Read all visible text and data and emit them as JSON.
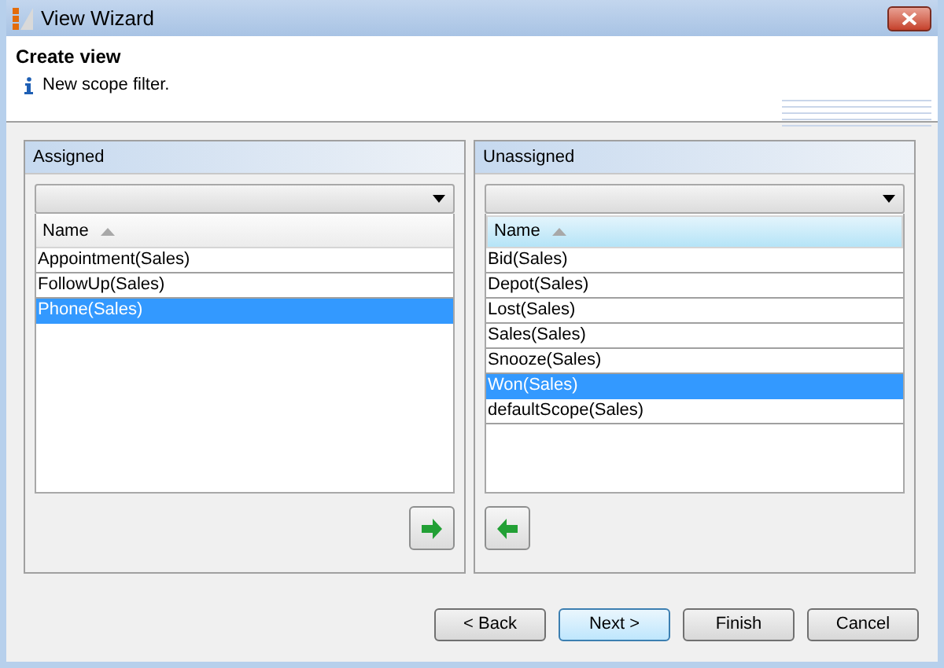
{
  "window": {
    "title": "View Wizard"
  },
  "header": {
    "title": "Create view",
    "message": "New scope filter."
  },
  "panels": [
    {
      "title": "Assigned",
      "column": "Name",
      "column_focused": false,
      "kind": "right",
      "rows": [
        {
          "label": "Appointment(Sales)",
          "selected": false
        },
        {
          "label": "FollowUp(Sales)",
          "selected": false
        },
        {
          "label": "Phone(Sales)",
          "selected": true
        }
      ]
    },
    {
      "title": "Unassigned",
      "column": "Name",
      "column_focused": true,
      "kind": "left",
      "rows": [
        {
          "label": "Bid(Sales)",
          "selected": false
        },
        {
          "label": "Depot(Sales)",
          "selected": false
        },
        {
          "label": "Lost(Sales)",
          "selected": false
        },
        {
          "label": "Sales(Sales)",
          "selected": false
        },
        {
          "label": "Snooze(Sales)",
          "selected": false
        },
        {
          "label": "Won(Sales)",
          "selected": true
        },
        {
          "label": "defaultScope(Sales)",
          "selected": false
        }
      ]
    }
  ],
  "buttons": [
    {
      "label": "< Back",
      "default": false
    },
    {
      "label": "Next >",
      "default": true
    },
    {
      "label": "Finish",
      "default": false
    },
    {
      "label": "Cancel",
      "default": false
    }
  ]
}
